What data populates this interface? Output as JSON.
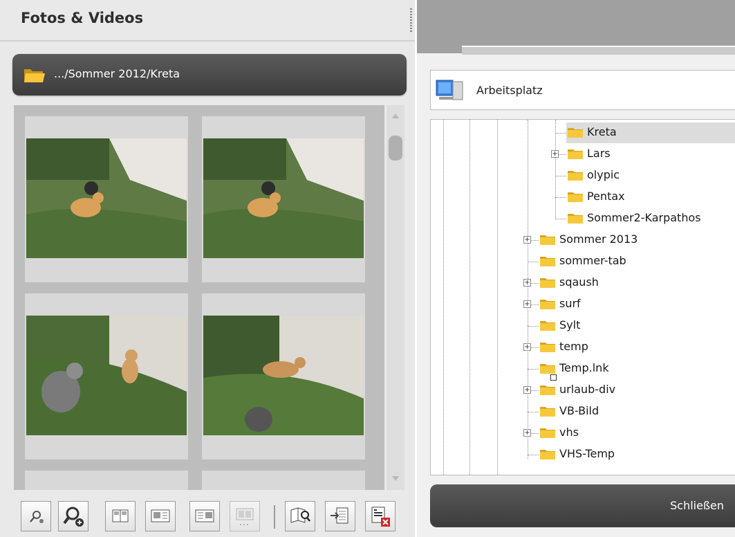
{
  "left_panel": {
    "title": "Fotos & Videos",
    "path": ".../Sommer 2012/Kreta"
  },
  "thumbnails": [
    {
      "scene": "dog-grass"
    },
    {
      "scene": "dog-grass"
    },
    {
      "scene": "two-dogs"
    },
    {
      "scene": "dog-shade"
    }
  ],
  "toolbar": {
    "buttons": [
      {
        "icon": "zoom-out-icon"
      },
      {
        "icon": "zoom-in-icon"
      },
      {
        "icon": "view-two-columns-icon"
      },
      {
        "icon": "view-detail-icon"
      },
      {
        "icon": "view-detail-alt-icon"
      },
      {
        "icon": "view-filmstrip-icon"
      },
      {
        "icon": "open-book-search-icon"
      },
      {
        "icon": "export-icon"
      },
      {
        "icon": "delete-icon"
      }
    ]
  },
  "right_panel": {
    "location": "Arbeitsplatz",
    "tree": [
      {
        "label": "Kreta",
        "level": 2,
        "expander": false,
        "selected": true
      },
      {
        "label": "Lars",
        "level": 2,
        "expander": true
      },
      {
        "label": "olypic",
        "level": 2,
        "expander": false
      },
      {
        "label": "Pentax",
        "level": 2,
        "expander": false
      },
      {
        "label": "Sommer2-Karpathos",
        "level": 2,
        "expander": false
      },
      {
        "label": "Sommer 2013",
        "level": 1,
        "expander": true
      },
      {
        "label": "sommer-tab",
        "level": 1,
        "expander": false
      },
      {
        "label": "sqaush",
        "level": 1,
        "expander": true
      },
      {
        "label": "surf",
        "level": 1,
        "expander": true
      },
      {
        "label": "Sylt",
        "level": 1,
        "expander": false
      },
      {
        "label": "temp",
        "level": 1,
        "expander": true
      },
      {
        "label": "Temp.lnk",
        "level": 1,
        "expander": false,
        "shortcut": true
      },
      {
        "label": "urlaub-div",
        "level": 1,
        "expander": true
      },
      {
        "label": "VB-Bild",
        "level": 1,
        "expander": false
      },
      {
        "label": "vhs",
        "level": 1,
        "expander": true
      },
      {
        "label": "VHS-Temp",
        "level": 1,
        "expander": false
      }
    ],
    "close_label": "Schließen"
  },
  "colors": {
    "bar_dark": "#3c3c3c",
    "panel_bg": "#e9e9e9",
    "folder": "#f3c22a"
  }
}
